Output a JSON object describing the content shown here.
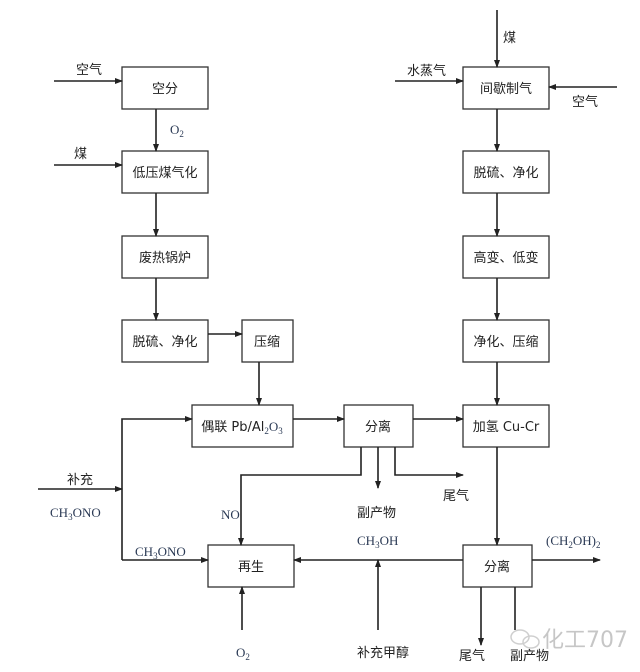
{
  "boxes": {
    "air_separation": "空分",
    "low_pressure_gasification": "低压煤气化",
    "waste_heat_boiler": "废热锅炉",
    "desulfurization_left": "脱硫、净化",
    "compression": "压缩",
    "coupling": {
      "prefix": "偶联 Pb/Al",
      "sub1": "2",
      "mid": "O",
      "sub2": "3"
    },
    "separation_mid": "分离",
    "intermittent_gas": "间歇制气",
    "desulfurization_right": "脱硫、净化",
    "shift": "高变、低变",
    "purify_compress": "净化、压缩",
    "hydrogenation": "加氢 Cu-Cr",
    "regeneration": "再生",
    "separation_final": "分离"
  },
  "labels": {
    "air_left": "空气",
    "coal_left": "煤",
    "o2_mid": {
      "main": "O",
      "sub": "2"
    },
    "coal_top": "煤",
    "steam": "水蒸气",
    "air_right": "空气",
    "supplement": "补充",
    "ch3ono_supplement": {
      "a": "CH",
      "sub": "3",
      "b": "ONO"
    },
    "ch3ono_recycle": {
      "a": "CH",
      "sub": "3",
      "b": "ONO"
    },
    "no": "NO",
    "byproduct_mid": "副产物",
    "tail_gas_mid": "尾气",
    "ch3oh": {
      "a": "CH",
      "sub": "3",
      "b": "OH"
    },
    "product": {
      "a": "(CH",
      "sub1": "2",
      "b": "OH)",
      "sub2": "2"
    },
    "o2_bottom": {
      "main": "O",
      "sub": "2"
    },
    "supplement_methanol": "补充甲醇",
    "tail_gas_bottom": "尾气",
    "byproduct_bottom": "副产物"
  },
  "watermark": "化工707"
}
